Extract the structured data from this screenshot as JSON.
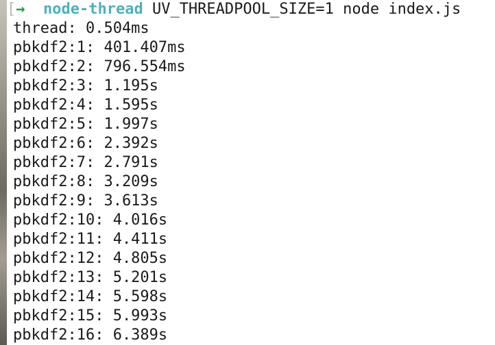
{
  "colors": {
    "background": "#ffffff",
    "text": "#1a1a1a",
    "arrow": "#1fa34a",
    "directory": "#4fb0bd",
    "bracket": "#b9b9b9"
  },
  "prompt": {
    "bracket": "[",
    "arrow": "→",
    "directory": "node-thread",
    "command": "UV_THREADPOOL_SIZE=1 node index.js"
  },
  "output": [
    "thread: 0.504ms",
    "pbkdf2:1: 401.407ms",
    "pbkdf2:2: 796.554ms",
    "pbkdf2:3: 1.195s",
    "pbkdf2:4: 1.595s",
    "pbkdf2:5: 1.997s",
    "pbkdf2:6: 2.392s",
    "pbkdf2:7: 2.791s",
    "pbkdf2:8: 3.209s",
    "pbkdf2:9: 3.613s",
    "pbkdf2:10: 4.016s",
    "pbkdf2:11: 4.411s",
    "pbkdf2:12: 4.805s",
    "pbkdf2:13: 5.201s",
    "pbkdf2:14: 5.598s",
    "pbkdf2:15: 5.993s",
    "pbkdf2:16: 6.389s"
  ]
}
